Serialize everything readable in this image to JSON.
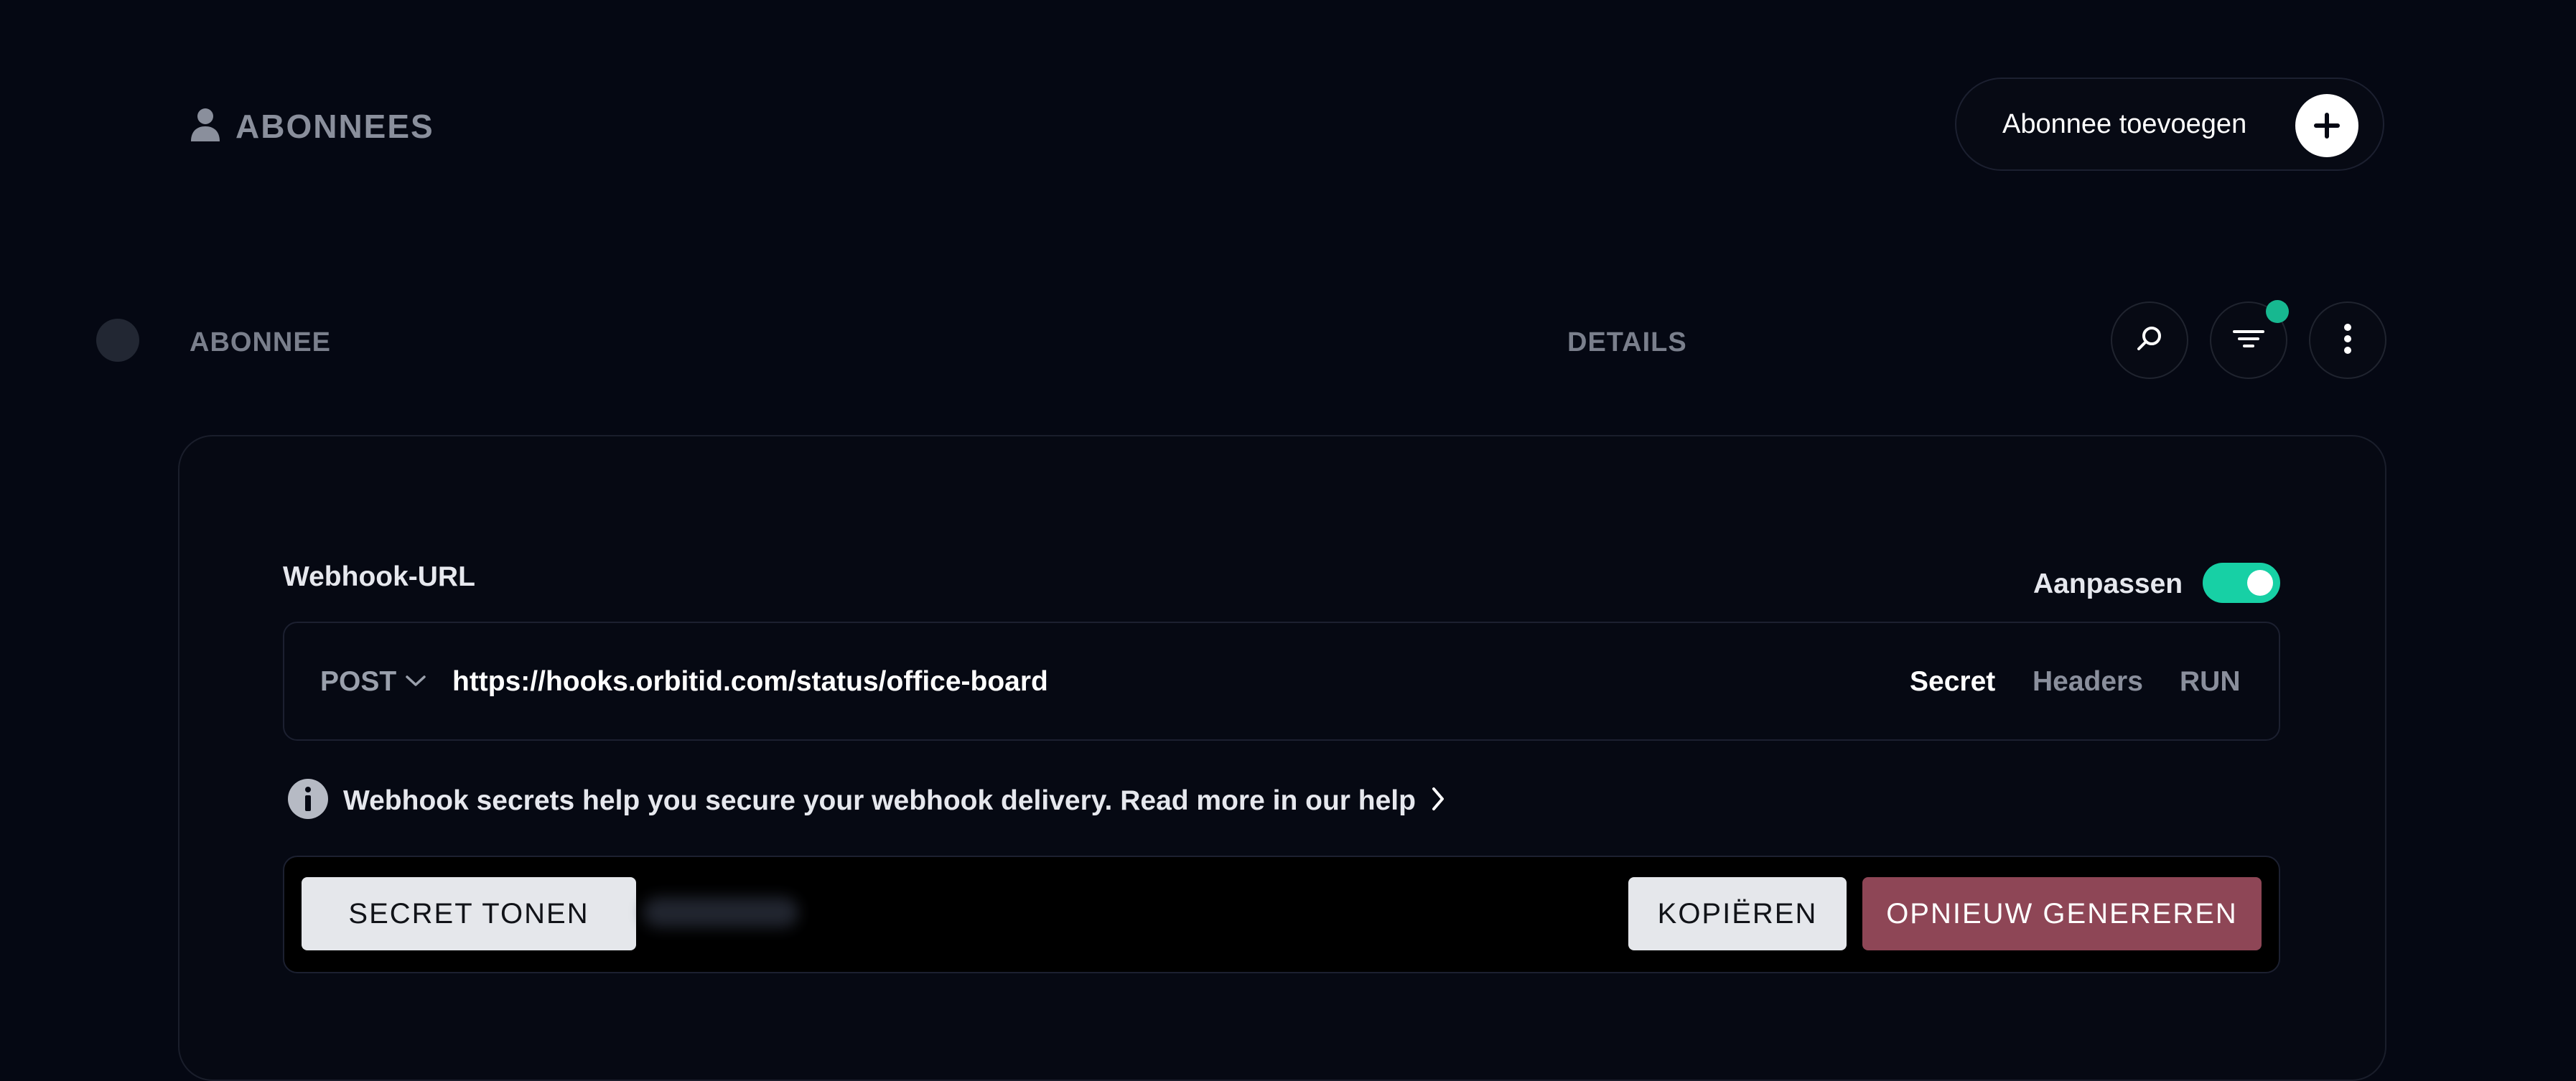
{
  "header": {
    "title": "ABONNEES",
    "title_icon": "person-icon",
    "add_button_label": "Abonnee toevoegen",
    "add_button_icon": "plus-icon"
  },
  "columns": {
    "subscriber": "ABONNEE",
    "details": "DETAILS"
  },
  "toolbar": {
    "search_icon": "search-icon",
    "filter_icon": "filter-icon",
    "more_icon": "more-vertical-icon",
    "filter_active": true
  },
  "webhook": {
    "label": "Webhook-URL",
    "toggle_label": "Aanpassen",
    "toggle_on": true,
    "method": "POST",
    "url": "https://hooks.orbitid.com/status/office-board",
    "tabs": [
      {
        "label": "Secret",
        "active": true
      },
      {
        "label": "Headers",
        "active": false
      },
      {
        "label": "RUN",
        "active": false
      }
    ],
    "info_text": "Webhook secrets help you secure your webhook delivery. Read more in our help",
    "show_secret_label": "SECRET TONEN",
    "copy_label": "KOPIËREN",
    "regenerate_label": "OPNIEUW GENEREREN"
  },
  "colors": {
    "background": "#050813",
    "accent": "#17d0a5",
    "danger": "#8e4656"
  }
}
